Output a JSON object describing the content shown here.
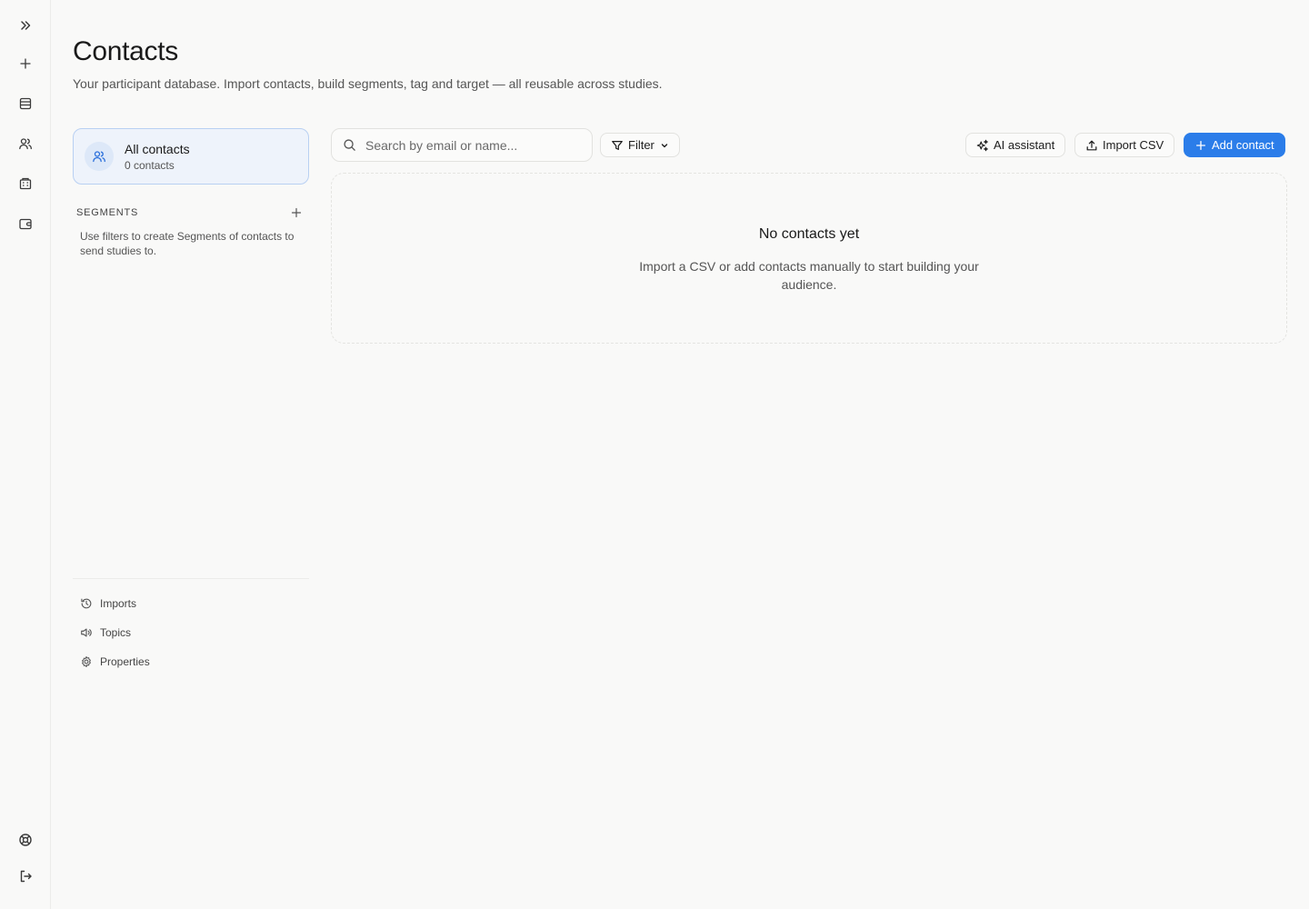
{
  "rail": {
    "items": [
      {
        "icon": "expand-icon"
      },
      {
        "icon": "plus-icon"
      },
      {
        "icon": "studies-icon"
      },
      {
        "icon": "contacts-icon"
      },
      {
        "icon": "building-icon"
      },
      {
        "icon": "wallet-icon"
      }
    ],
    "bottom": [
      {
        "icon": "help-lifebuoy-icon"
      },
      {
        "icon": "logout-icon"
      }
    ]
  },
  "header": {
    "title": "Contacts",
    "subtitle": "Your participant database. Import contacts, build segments, tag and target — all reusable across studies."
  },
  "sidebar": {
    "all_contacts": {
      "title": "All contacts",
      "count": "0 contacts"
    },
    "segments": {
      "label": "SEGMENTS",
      "help": "Use filters to create Segments of contacts to send studies to."
    },
    "links": [
      {
        "label": "Imports",
        "icon": "history-icon"
      },
      {
        "label": "Topics",
        "icon": "megaphone-icon"
      },
      {
        "label": "Properties",
        "icon": "gear-icon"
      }
    ]
  },
  "toolbar": {
    "search_placeholder": "Search by email or name...",
    "filter_label": "Filter",
    "ai_label": "AI assistant",
    "import_label": "Import CSV",
    "add_label": "Add contact"
  },
  "empty_state": {
    "title": "No contacts yet",
    "description": "Import a CSV or add contacts manually to start building your audience."
  },
  "colors": {
    "accent": "#2b7de9",
    "selected_bg": "#eef3fb",
    "selected_border": "#b9d0f2",
    "background": "#f9f9f8"
  }
}
